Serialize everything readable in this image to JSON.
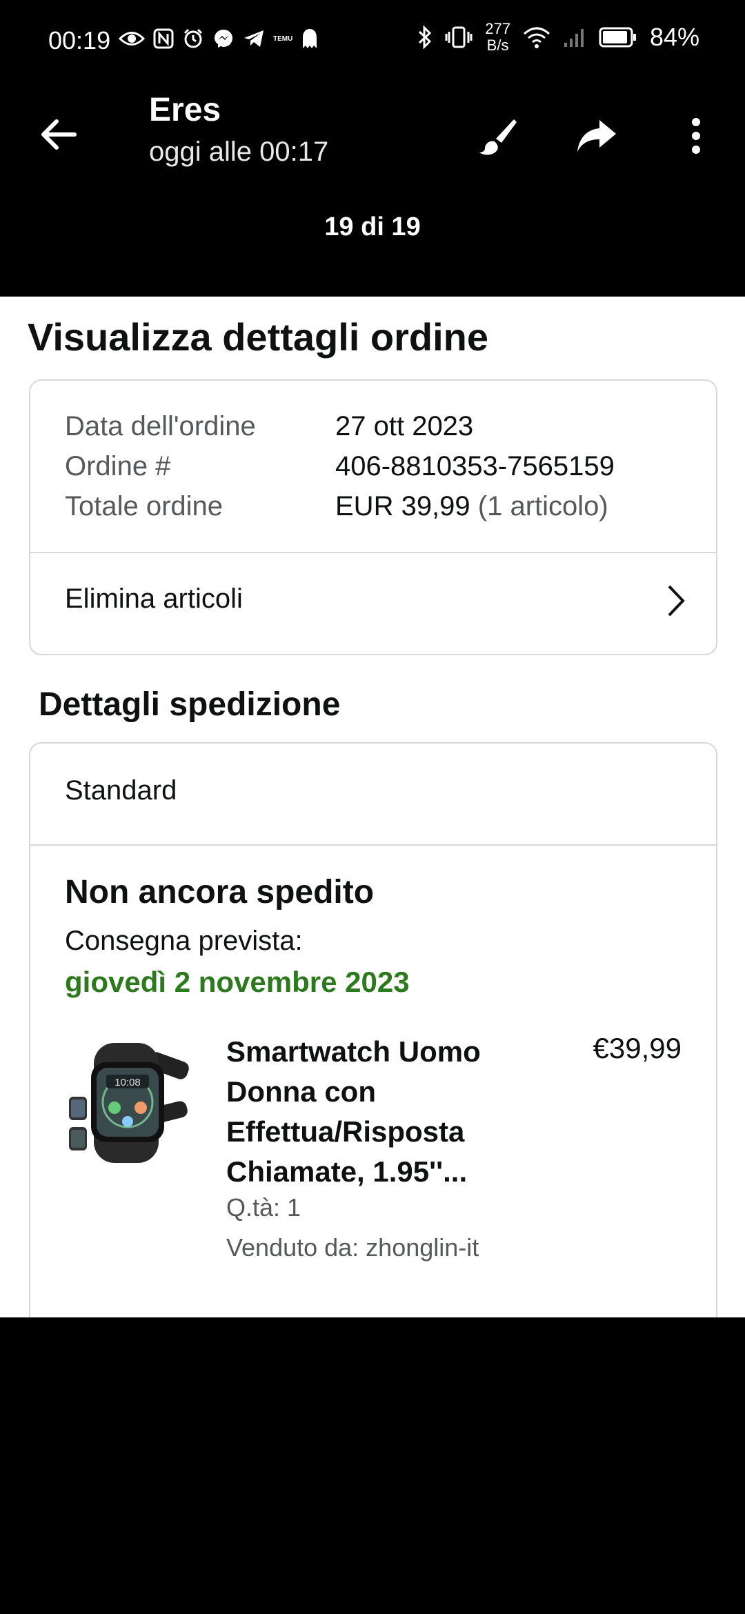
{
  "status_bar": {
    "time": "00:19",
    "left_icons": [
      "eye-icon",
      "nfc-icon",
      "alarm-icon",
      "messenger-icon",
      "telegram-icon",
      "temu-icon",
      "ghost-icon"
    ],
    "left_icon_temu_text": "TEMU",
    "speed_value": "277",
    "speed_unit": "B/s",
    "battery": "84%"
  },
  "header": {
    "title": "Eres",
    "subtitle": "oggi alle 00:17",
    "counter": "19 di 19"
  },
  "page": {
    "title": "Visualizza dettagli ordine",
    "order": {
      "date_label": "Data dell'ordine",
      "date_value": "27 ott 2023",
      "number_label": "Ordine #",
      "number_value": "406-8810353-7565159",
      "total_label": "Totale ordine",
      "total_value": "EUR 39,99",
      "total_items": "(1 articolo)"
    },
    "delete_items": "Elimina articoli",
    "shipping_title": "Dettagli spedizione",
    "shipping": {
      "method": "Standard",
      "status": "Non ancora spedito",
      "delivery_label": "Consegna prevista:",
      "delivery_date": "giovedì 2 novembre 2023",
      "product_name_lines": [
        "Smartwatch Uomo",
        "Donna con",
        "Effettua/Risposta",
        "Chiamate, 1.95''..."
      ],
      "price": "€39,99",
      "qty": "Q.tà: 1",
      "seller": "Venduto da: zhonglin-it",
      "watch_face_time": "10:08"
    }
  },
  "colors": {
    "delivery_green": "#2c7a1d",
    "border": "#d5d9d9",
    "muted_text": "#565959"
  }
}
